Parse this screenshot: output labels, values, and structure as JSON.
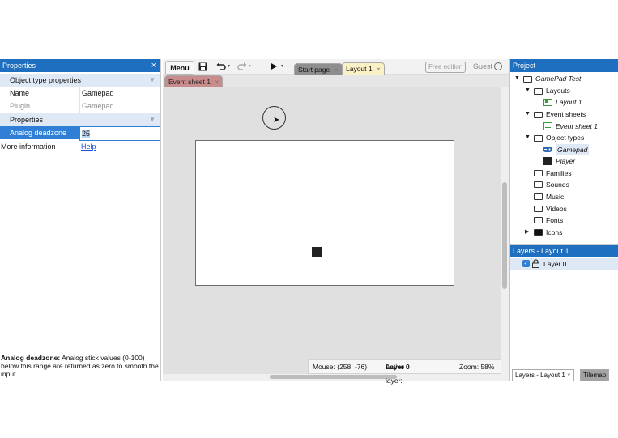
{
  "properties_panel": {
    "title": "Properties",
    "close": "×",
    "section_object_type": "Object type properties",
    "rows_object_type": [
      {
        "key": "Name",
        "value": "Gamepad"
      },
      {
        "key": "Plugin",
        "value": "Gamepad"
      }
    ],
    "section_properties": "Properties",
    "deadzone_key": "Analog deadzone",
    "deadzone_value": "25",
    "more_info_key": "More information",
    "more_info_link": "Help",
    "description_bold": "Analog deadzone:",
    "description_text": " Analog stick values (0-100) below this range are returned as zero to smooth the input."
  },
  "toolbar": {
    "menu_label": "Menu",
    "save_icon": "save-icon",
    "undo_icon": "undo-icon",
    "redo_icon": "redo-icon",
    "play_icon": "play-icon",
    "tabs": [
      {
        "label": "Start page",
        "close": "×"
      },
      {
        "label": "Layout 1",
        "close": "×"
      }
    ],
    "free_edition": "Free edition",
    "guest": "Guest"
  },
  "subtabs": [
    {
      "label": "Event sheet 1",
      "close": "×"
    }
  ],
  "status_bar": {
    "mouse": "Mouse: (258, -76)",
    "active_layer_label": "Active layer: ",
    "active_layer_value": "Layer 0",
    "zoom": "Zoom: 58%"
  },
  "project_panel": {
    "title": "Project",
    "tree": [
      {
        "label": "GamePad Test",
        "italic": true,
        "level": 0
      },
      {
        "label": "Layouts",
        "level": 1
      },
      {
        "label": "Layout 1",
        "italic": true,
        "level": 2
      },
      {
        "label": "Event sheets",
        "level": 1
      },
      {
        "label": "Event sheet 1",
        "italic": true,
        "level": 2
      },
      {
        "label": "Object types",
        "level": 1
      },
      {
        "label": "Gamepad",
        "italic": true,
        "level": 2
      },
      {
        "label": "Player",
        "italic": true,
        "level": 2
      },
      {
        "label": "Families",
        "level": 1
      },
      {
        "label": "Sounds",
        "level": 1
      },
      {
        "label": "Music",
        "level": 1
      },
      {
        "label": "Videos",
        "level": 1
      },
      {
        "label": "Fonts",
        "level": 1
      },
      {
        "label": "Icons",
        "level": 1
      }
    ]
  },
  "layers_panel": {
    "title": "Layers - Layout 1",
    "layer": "Layer 0",
    "bottom_tabs": [
      {
        "label": "Layers - Layout 1",
        "close": "×"
      },
      {
        "label": "Tilemap"
      }
    ]
  },
  "colors": {
    "panel_header": "#1e6fbf",
    "selected_row": "#2f7fd6",
    "tab_active": "#fbf1c7",
    "event_tab": "#c98c8c",
    "canvas_bg": "#e0e0e0"
  }
}
